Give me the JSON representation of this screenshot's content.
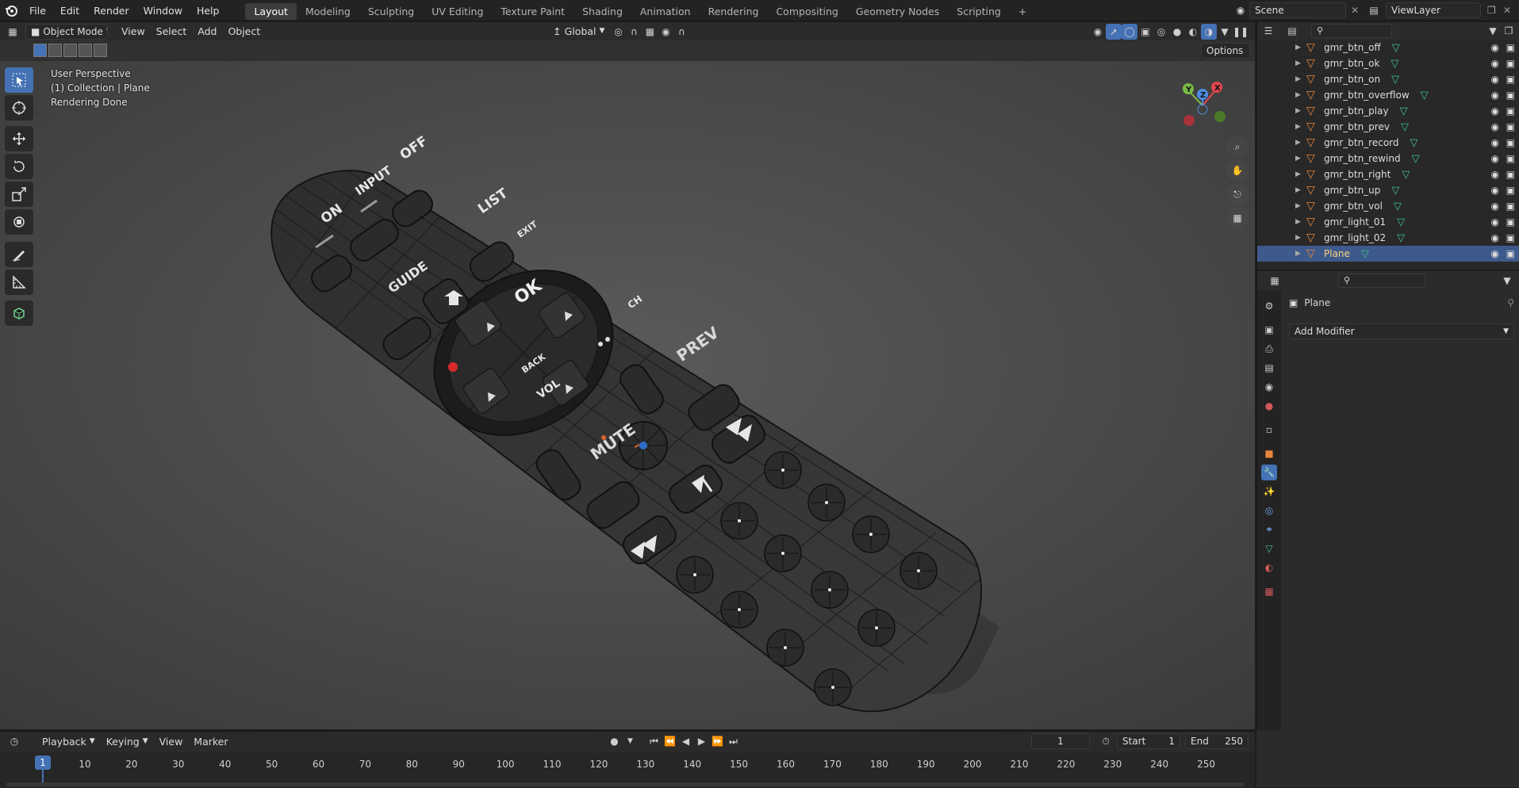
{
  "topbar": {
    "menus": [
      "File",
      "Edit",
      "Render",
      "Window",
      "Help"
    ],
    "workspaces": [
      "Layout",
      "Modeling",
      "Sculpting",
      "UV Editing",
      "Texture Paint",
      "Shading",
      "Animation",
      "Rendering",
      "Compositing",
      "Geometry Nodes",
      "Scripting"
    ],
    "active_workspace": "Layout",
    "add_tab": "+",
    "scene": "Scene",
    "view_layer": "ViewLayer"
  },
  "viewport_header": {
    "mode": "Object Mode",
    "menus": [
      "View",
      "Select",
      "Add",
      "Object"
    ],
    "orientation": "Global",
    "options": "Options"
  },
  "overlay": {
    "line1": "User Perspective",
    "line2": "(1) Collection | Plane",
    "line3": "Rendering Done"
  },
  "gizmo": {
    "x": "X",
    "y": "Y",
    "z": "Z"
  },
  "outliner": {
    "items": [
      {
        "name": "gmr_btn_off",
        "selected": false
      },
      {
        "name": "gmr_btn_ok",
        "selected": false
      },
      {
        "name": "gmr_btn_on",
        "selected": false
      },
      {
        "name": "gmr_btn_overflow",
        "selected": false
      },
      {
        "name": "gmr_btn_play",
        "selected": false
      },
      {
        "name": "gmr_btn_prev",
        "selected": false
      },
      {
        "name": "gmr_btn_record",
        "selected": false
      },
      {
        "name": "gmr_btn_rewind",
        "selected": false
      },
      {
        "name": "gmr_btn_right",
        "selected": false
      },
      {
        "name": "gmr_btn_up",
        "selected": false
      },
      {
        "name": "gmr_btn_vol",
        "selected": false
      },
      {
        "name": "gmr_light_01",
        "selected": false
      },
      {
        "name": "gmr_light_02",
        "selected": false
      },
      {
        "name": "Plane",
        "selected": true
      }
    ]
  },
  "properties": {
    "object_name": "Plane",
    "add_modifier": "Add Modifier"
  },
  "timeline": {
    "menus": [
      "Playback",
      "Keying",
      "View",
      "Marker"
    ],
    "current_frame": "1",
    "start_label": "Start",
    "start": "1",
    "end_label": "End",
    "end": "250",
    "ticks": [
      "1",
      "10",
      "20",
      "30",
      "40",
      "50",
      "60",
      "70",
      "80",
      "90",
      "100",
      "110",
      "120",
      "130",
      "140",
      "150",
      "160",
      "170",
      "180",
      "190",
      "200",
      "210",
      "220",
      "230",
      "240",
      "250"
    ]
  },
  "remote": {
    "labels": {
      "on": "ON",
      "input": "INPUT",
      "off": "OFF",
      "list": "LIST",
      "guide": "GUIDE",
      "exit": "EXIT",
      "ok": "OK",
      "back": "BACK",
      "ch": "CH",
      "prev": "PREV",
      "vol": "VOL",
      "mute": "MUTE"
    }
  },
  "colors": {
    "accent": "#4472b4",
    "selection": "#3e5a8c",
    "object_orange": "#e8863a",
    "mesh_green": "#3fc48a"
  }
}
